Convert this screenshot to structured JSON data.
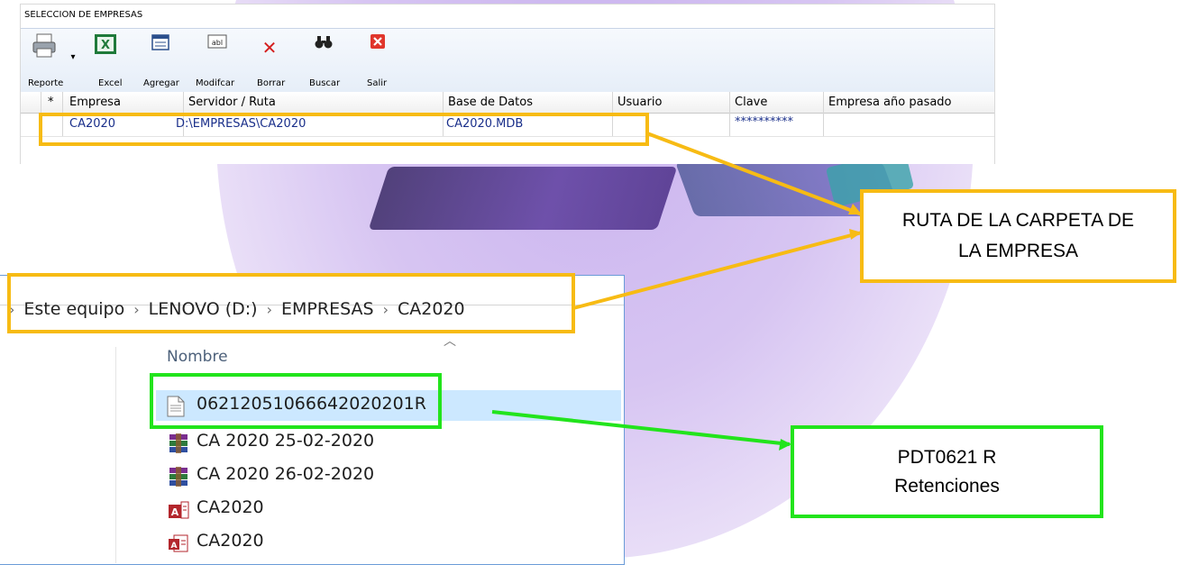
{
  "app": {
    "title": "SELECCION DE EMPRESAS",
    "toolbar": [
      {
        "key": "reporte",
        "label": "Reporte",
        "icon": "printer-icon"
      },
      {
        "key": "excel",
        "label": "Excel",
        "icon": "excel-icon"
      },
      {
        "key": "agregar",
        "label": "Agregar",
        "icon": "add-record-icon"
      },
      {
        "key": "modificar",
        "label": "Modifcar",
        "icon": "edit-field-icon"
      },
      {
        "key": "borrar",
        "label": "Borrar",
        "icon": "delete-x-icon"
      },
      {
        "key": "buscar",
        "label": "Buscar",
        "icon": "binoculars-icon"
      },
      {
        "key": "salir",
        "label": "Salir",
        "icon": "exit-icon"
      }
    ],
    "grid": {
      "columns": [
        "*",
        "Empresa",
        "Servidor / Ruta",
        "Base de Datos",
        "Usuario",
        "Clave",
        "Empresa año pasado"
      ],
      "rows": [
        {
          "empresa": "CA2020",
          "ruta": "D:\\EMPRESAS\\CA2020",
          "base": "CA2020.MDB",
          "usuario": "",
          "clave": "**********",
          "anio_pasado": ""
        }
      ]
    }
  },
  "explorer": {
    "breadcrumb": [
      "Este equipo",
      "LENOVO (D:)",
      "EMPRESAS",
      "CA2020"
    ],
    "column_header": "Nombre",
    "files": [
      {
        "name": "06212051066642020201R",
        "icon": "text-file-icon",
        "selected": true
      },
      {
        "name": "CA 2020 25-02-2020",
        "icon": "winrar-archive-icon",
        "selected": false
      },
      {
        "name": "CA 2020 26-02-2020",
        "icon": "winrar-archive-icon",
        "selected": false
      },
      {
        "name": "CA2020",
        "icon": "access-database-icon",
        "selected": false
      },
      {
        "name": "CA2020",
        "icon": "access-report-icon",
        "selected": false
      }
    ]
  },
  "annotations": {
    "ruta_callout": [
      "RUTA DE LA CARPETA DE",
      "LA EMPRESA"
    ],
    "pdt_callout": [
      "PDT0621 R",
      "Retenciones"
    ],
    "colors": {
      "orange": "#f7bb14",
      "green": "#22e41c"
    }
  }
}
